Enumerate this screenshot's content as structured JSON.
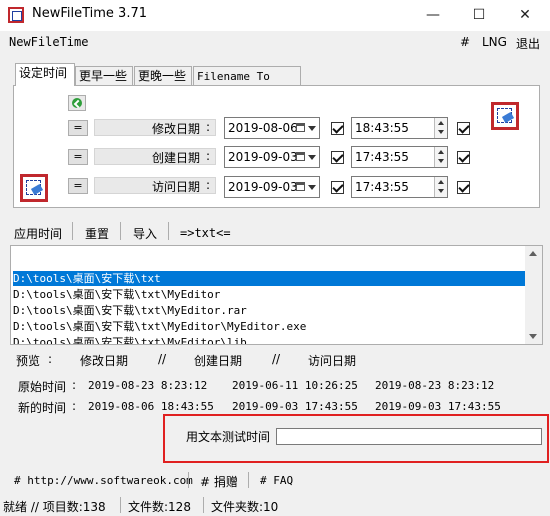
{
  "window": {
    "title": "NewFileTime 3.71",
    "minimize": "—",
    "maximize": "☐",
    "close": "✕"
  },
  "menu": {
    "app_name": "NewFileTime",
    "hash": "#",
    "lng": "LNG",
    "exit": "退出"
  },
  "tabs": [
    {
      "label": "设定时间",
      "active": true
    },
    {
      "label": "更早一些",
      "active": false
    },
    {
      "label": "更晚一些",
      "active": false
    },
    {
      "label": "Filename To Time",
      "active": false
    }
  ],
  "time_rows": [
    {
      "eq": "=",
      "label": "修改日期",
      "colon": ":",
      "date": "2019-08-06",
      "time": "18:43:55"
    },
    {
      "eq": "=",
      "label": "创建日期",
      "colon": ":",
      "date": "2019-09-03",
      "time": "17:43:55"
    },
    {
      "eq": "=",
      "label": "访问日期",
      "colon": ":",
      "date": "2019-09-03",
      "time": "17:43:55"
    }
  ],
  "actions": {
    "apply": "应用时间",
    "reset": "重置",
    "import": "导入",
    "convert": "=>txt<="
  },
  "files": [
    "D:\\tools\\桌面\\安下载\\txt",
    "D:\\tools\\桌面\\安下载\\txt\\MyEditor",
    "D:\\tools\\桌面\\安下载\\txt\\MyEditor.rar",
    "D:\\tools\\桌面\\安下载\\txt\\MyEditor\\MyEditor.exe",
    "D:\\tools\\桌面\\安下载\\txt\\MyEditor\\lib"
  ],
  "preview": {
    "header": {
      "preview": "预览",
      "sep": ":",
      "modified": "修改日期",
      "slash1": "//",
      "created": "创建日期",
      "slash2": "//",
      "accessed": "访问日期"
    },
    "original": {
      "label": "原始时间",
      "colon": ":",
      "modified": "2019-08-23 8:23:12",
      "created": "2019-06-11 10:26:25",
      "accessed": "2019-08-23 8:23:12"
    },
    "new": {
      "label": "新的时间",
      "colon": ":",
      "modified": "2019-08-06 18:43:55",
      "created": "2019-09-03 17:43:55",
      "accessed": "2019-09-03 17:43:55"
    }
  },
  "test": {
    "label": "用文本测试时间",
    "value": ""
  },
  "links": {
    "website": "# http://www.softwareok.com",
    "donate": "# 捐赠",
    "faq": "# FAQ"
  },
  "status": {
    "ready": "就绪 // 项目数:138",
    "files": "文件数:128",
    "folders": "文件夹数:10"
  }
}
